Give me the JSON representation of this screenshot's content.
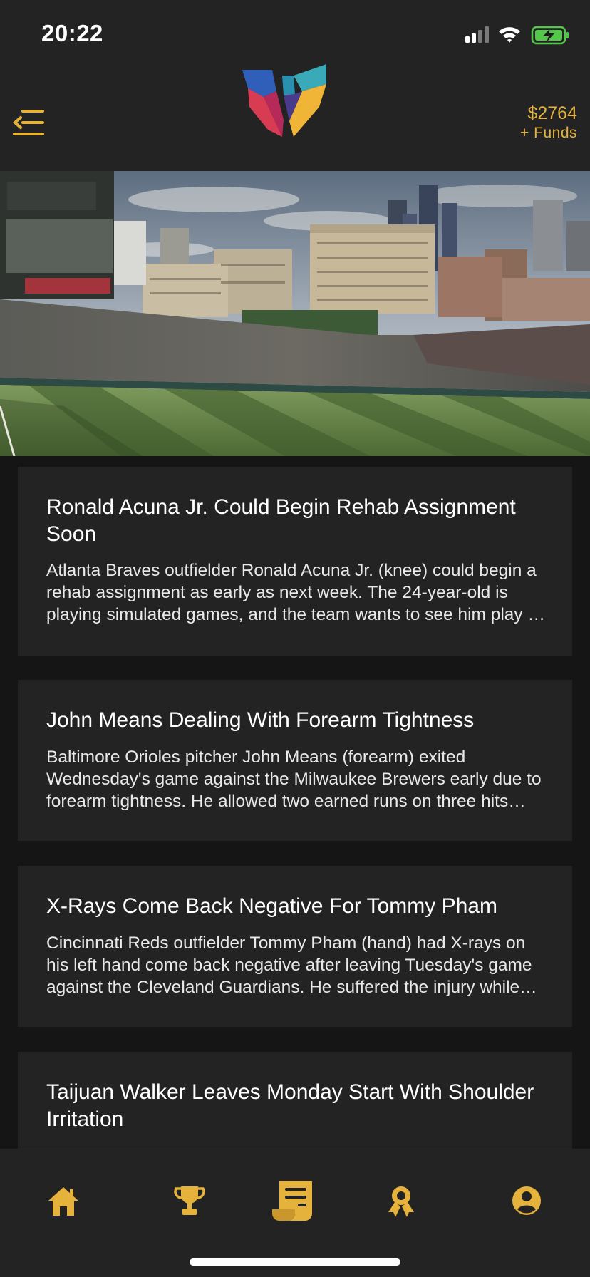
{
  "status_bar": {
    "time": "20:22"
  },
  "header": {
    "funds_amount": "$2764",
    "funds_link": "+ Funds"
  },
  "news": [
    {
      "title": "Ronald Acuna Jr. Could Begin Rehab Assignment Soon",
      "summary": "Atlanta Braves outfielder Ronald  Acuna  Jr. (knee) could begin a rehab assignment as early as next week. The 24-year-old is playing simulated games, and the team wants to see him play in minor league games before he returns."
    },
    {
      "title": "John Means Dealing With Forearm Tightness",
      "summary": "Baltimore Orioles pitcher John  Means (forearm) exited Wednesday's game against the Milwaukee Brewers early due to forearm tightness. He allowed two earned runs on three hits before leaving the game."
    },
    {
      "title": "X-Rays Come Back Negative For Tommy Pham",
      "summary": "Cincinnati Reds outfielder Tommy  Pham (hand) had X-rays on his left hand come back negative after leaving Tuesday's game against the Cleveland Guardians. He suffered the injury while sliding into second base."
    },
    {
      "title": "Taijuan Walker Leaves Monday Start With Shoulder Irritation",
      "summary": ""
    }
  ],
  "tabs": [
    {
      "icon": "home-icon"
    },
    {
      "icon": "trophy-icon"
    },
    {
      "icon": "news-scroll-icon",
      "active": true
    },
    {
      "icon": "award-ribbon-icon"
    },
    {
      "icon": "profile-icon"
    }
  ],
  "colors": {
    "accent": "#e5b23c",
    "background": "#151515",
    "surface": "#232323"
  }
}
